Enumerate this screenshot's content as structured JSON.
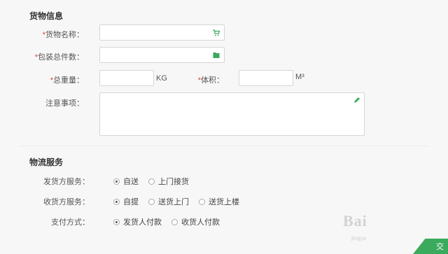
{
  "cargo": {
    "title": "货物信息",
    "name_label": "货物名称：",
    "pieces_label": "包装总件数：",
    "weight_label": "总重量：",
    "weight_unit": "KG",
    "volume_label": "体积：",
    "volume_unit": "M³",
    "notes_label": "注意事项：",
    "name_value": "",
    "pieces_value": "",
    "weight_value": "",
    "volume_value": "",
    "notes_value": ""
  },
  "logistics": {
    "title": "物流服务",
    "shipper_label": "发货方服务：",
    "shipper_options": [
      "自送",
      "上门接货"
    ],
    "shipper_selected": 0,
    "receiver_label": "收货方服务：",
    "receiver_options": [
      "自提",
      "送货上门",
      "送货上楼"
    ],
    "receiver_selected": 0,
    "payment_label": "支付方式：",
    "payment_options": [
      "发货人付款",
      "收货人付款"
    ],
    "payment_selected": 0
  },
  "watermark": {
    "main": "Bai",
    "sub": "jingya"
  },
  "corner": {
    "label": "交"
  },
  "colors": {
    "accent": "#3aaa5c",
    "required": "#e23b3b"
  }
}
